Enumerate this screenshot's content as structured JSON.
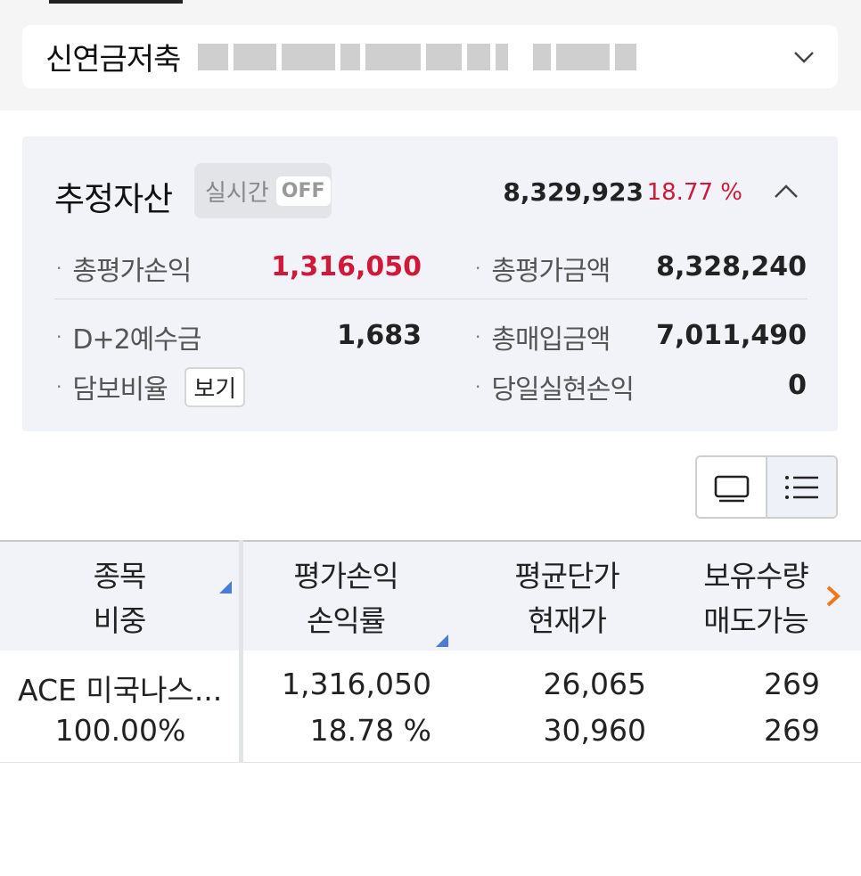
{
  "account": {
    "type": "신연금저축",
    "dropdown_icon": "chevron-down-icon"
  },
  "summary": {
    "title": "추정자산",
    "realtime_label": "실시간",
    "realtime_state": "OFF",
    "total_value": "8,329,923",
    "total_rate": "18.77 %",
    "collapse_icon": "chevron-up-icon",
    "items": [
      {
        "label": "총평가손익",
        "value": "1,316,050"
      },
      {
        "label": "총평가금액",
        "value": "8,328,240"
      },
      {
        "label": "D+2예수금",
        "value": "1,683"
      },
      {
        "label": "총매입금액",
        "value": "7,011,490"
      },
      {
        "label": "담보비율",
        "button": "보기"
      },
      {
        "label": "당일실현손익",
        "value": "0"
      }
    ]
  },
  "view_toggle": {
    "card_icon": "card-view-icon",
    "list_icon": "list-view-icon"
  },
  "table": {
    "headers": [
      [
        "종목",
        "비중"
      ],
      [
        "평가손익",
        "손익률"
      ],
      [
        "평균단가",
        "현재가"
      ],
      [
        "보유수량",
        "매도가능"
      ]
    ],
    "rows": [
      {
        "name": "ACE 미국나스...",
        "weight": "100.00%",
        "pnl": "1,316,050",
        "pnl_rate": "18.78 %",
        "avg_price": "26,065",
        "current_price": "30,960",
        "quantity": "269",
        "sellable": "269"
      }
    ]
  },
  "colors": {
    "profit": "#d01838",
    "panel_bg": "#f1f3f8",
    "sort_indicator": "#4a7bd6",
    "scroll_hint": "#f07818"
  }
}
